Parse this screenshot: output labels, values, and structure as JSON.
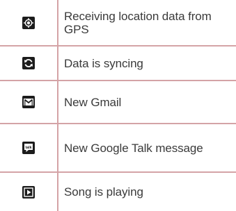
{
  "rows": [
    {
      "icon": "gps-icon",
      "description": "Receiving location data from GPS"
    },
    {
      "icon": "sync-icon",
      "description": "Data is syncing"
    },
    {
      "icon": "gmail-icon",
      "description": "New Gmail"
    },
    {
      "icon": "talk-icon",
      "icon_text": "talk",
      "description": "New Google Talk message"
    },
    {
      "icon": "play-icon",
      "description": "Song is playing"
    }
  ],
  "colors": {
    "border": "#d4a3a6",
    "icon_bg": "#1c1c1c",
    "text": "#3a3a3a"
  }
}
